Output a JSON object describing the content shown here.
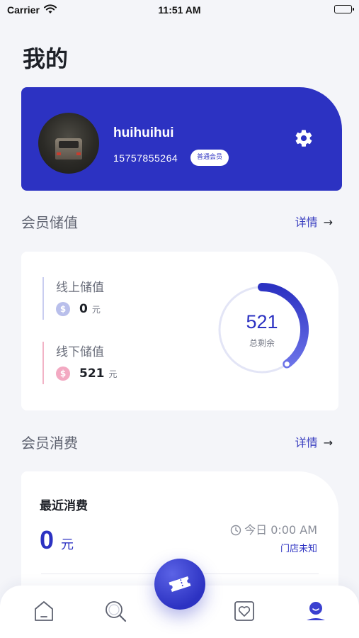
{
  "status_bar": {
    "carrier": "Carrier",
    "time": "11:51 AM"
  },
  "page": {
    "title": "我的"
  },
  "profile": {
    "username": "huihuihui",
    "phone": "15757855264",
    "badge": "普通会员"
  },
  "stored_value": {
    "section_title": "会员储值",
    "more_label": "详情",
    "online": {
      "label": "线上储值",
      "amount": "0",
      "unit": "元"
    },
    "offline": {
      "label": "线下储值",
      "amount": "521",
      "unit": "元"
    },
    "ring": {
      "value": "521",
      "label": "总剩余",
      "fill_fraction": 0.4
    }
  },
  "consumption": {
    "section_title": "会员消费",
    "more_label": "详情",
    "card_title": "最近消费",
    "amount": "0",
    "unit": "元",
    "time": "今日 0:00 AM",
    "store": "门店未知"
  },
  "colors": {
    "accent": "#2c32c2",
    "background": "#f4f5f9",
    "online_coin": "#b9bfeb",
    "offline_coin": "#f3a9c2"
  },
  "icons": [
    "wifi-icon",
    "battery-icon",
    "gear-icon",
    "arrow-right-icon",
    "coin-icon",
    "clock-icon",
    "home-icon",
    "search-icon",
    "ticket-icon",
    "heart-icon",
    "user-icon"
  ]
}
